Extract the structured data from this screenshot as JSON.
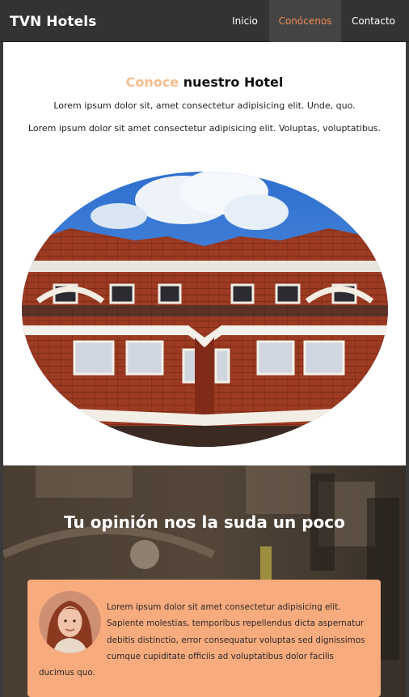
{
  "navbar": {
    "brand": "TVN Hotels",
    "links": [
      {
        "label": "Inicio",
        "active": false
      },
      {
        "label": "Conócenos",
        "active": true
      },
      {
        "label": "Contacto",
        "active": false
      }
    ],
    "colors": {
      "background": "#333333",
      "active_background": "#444444",
      "active_text": "#f28c52"
    }
  },
  "about": {
    "title_accent": "Conoce",
    "title_rest": " nuestro Hotel",
    "paragraph_1": "Lorem ipsum dolor sit, amet consectetur adipisicing elit. Unde, quo.",
    "paragraph_2": "Lorem ipsum dolor sit amet consectetur adipisicing elit. Voluptas, voluptatibus.",
    "image": "hotel-building-ellipse-photo",
    "accent_color": "#f6bd8d"
  },
  "testimonials": {
    "title": "Tu opinión nos la suda un poco",
    "background_image": "street-building-photo",
    "card": {
      "avatar": "woman-portrait-avatar",
      "text": "Lorem ipsum dolor sit amet consectetur adipisicing elit. Sapiente molestias, temporibus repellendus dicta aspernatur debitis distinctio, error consequatur voluptas sed dignissimos cumque cupiditate officiis ad voluptatibus dolor facilis ducimus quo.",
      "background": "#f8ab7d"
    }
  }
}
